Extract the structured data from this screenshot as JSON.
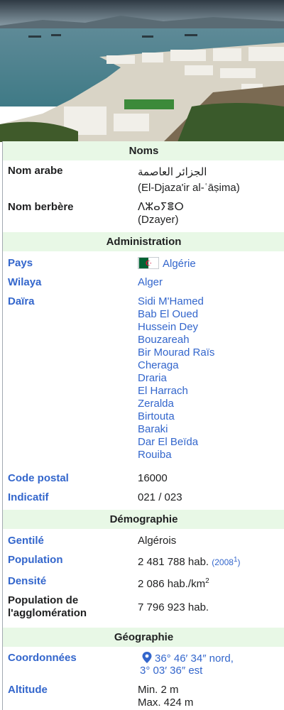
{
  "noms": {
    "header": "Noms",
    "arabic_label": "Nom arabe",
    "arabic_value": "الجزائر العاصمة",
    "arabic_translit": "(El-Djaza'ir al-ʿāṣima)",
    "berber_label": "Nom berbère",
    "berber_value": "ⴷⵣⴰⵢⴻⵔ",
    "berber_translit": "(Dzayer)"
  },
  "administration": {
    "header": "Administration",
    "pays_label": "Pays",
    "pays_value": "Algérie",
    "wilaya_label": "Wilaya",
    "wilaya_value": "Alger",
    "daira_label": "Daïra",
    "dairas": [
      "Sidi M'Hamed",
      "Bab El Oued",
      "Hussein Dey",
      "Bouzareah",
      "Bir Mourad Raïs",
      "Cheraga",
      "Draria",
      "El Harrach",
      "Zeralda",
      "Birtouta",
      "Baraki",
      "Dar El Beïda",
      "Rouiba"
    ],
    "code_postal_label": "Code postal",
    "code_postal_value": "16000",
    "indicatif_label": "Indicatif",
    "indicatif_value": "021 / 023"
  },
  "demographie": {
    "header": "Démographie",
    "gentile_label": "Gentilé",
    "gentile_value": "Algérois",
    "population_label": "Population",
    "population_value": "2 481 788 hab.",
    "population_year": "(2008",
    "population_ref": "1",
    "population_close": ")",
    "densite_label": "Densité",
    "densite_value": "2 086 hab./km",
    "densite_exp": "2",
    "agglo_label_line1": "Population de",
    "agglo_label_line2": "l'agglomération",
    "agglo_value": "7 796 923 hab."
  },
  "geographie": {
    "header": "Géographie",
    "coord_label": "Coordonnées",
    "coord_line1": "36° 46′ 34″ nord,",
    "coord_line2": "3° 03′ 36″ est",
    "altitude_label": "Altitude",
    "altitude_min": "Min. 2 m",
    "altitude_max": "Max. 424 m"
  },
  "colors": {
    "link": "#3366cc",
    "header_bg": "#e8f8e6",
    "text": "#202122"
  }
}
